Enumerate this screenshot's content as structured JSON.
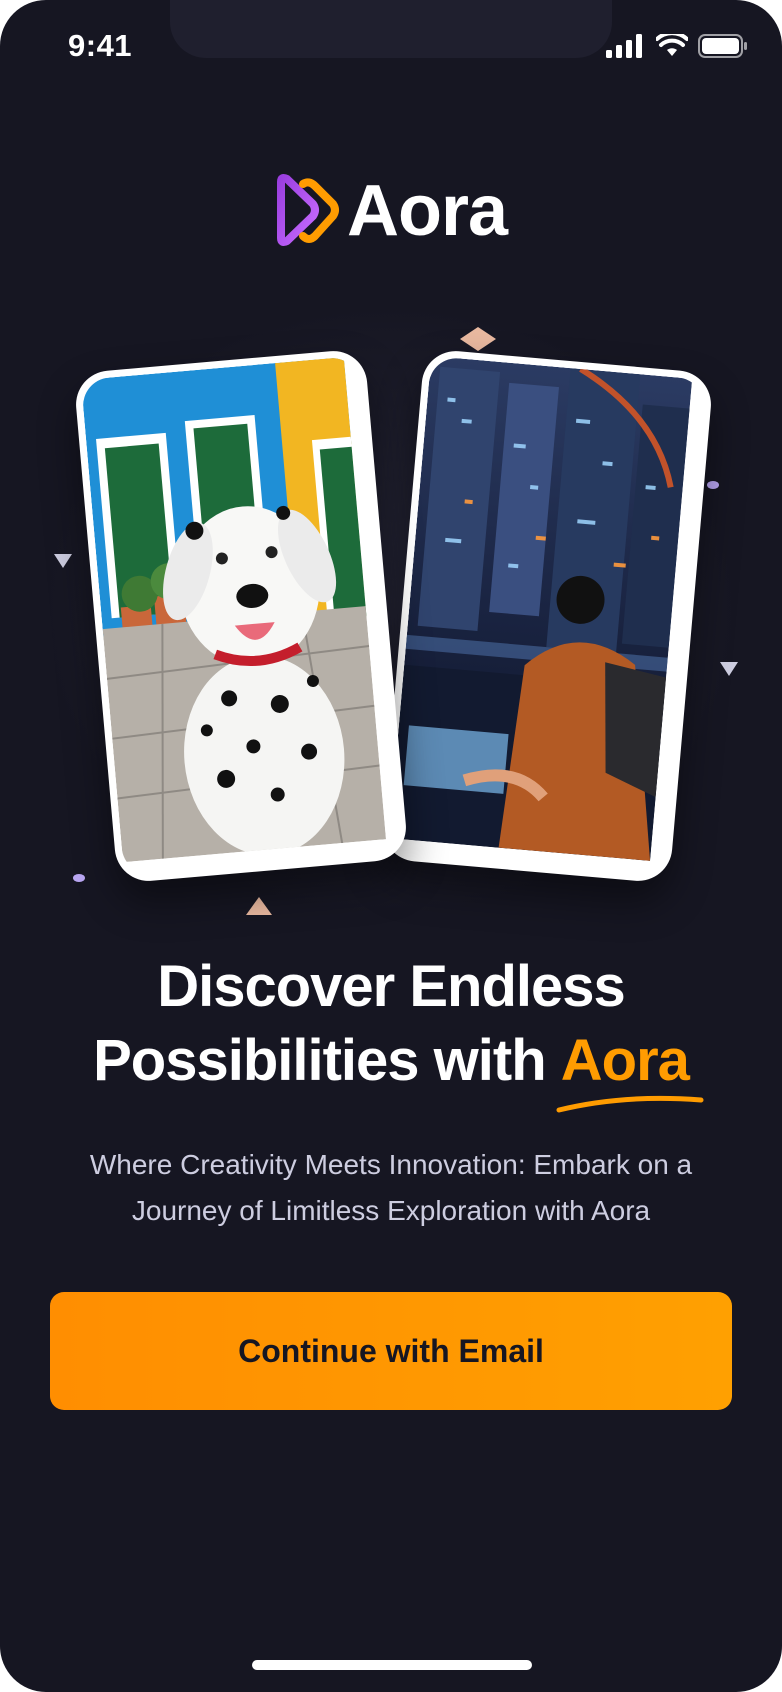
{
  "status_bar": {
    "time": "9:41"
  },
  "brand": {
    "name": "Aora",
    "logo_colors": [
      "#8B3FD9",
      "#FF9C01"
    ]
  },
  "hero": {
    "cards": [
      {
        "name": "dalmatian-dog-photo"
      },
      {
        "name": "cyberpunk-city-photo"
      }
    ]
  },
  "headline": {
    "line1": "Discover Endless",
    "line2_prefix": "Possibilities with ",
    "accent": "Aora",
    "accent_color": "#FF9C01"
  },
  "subtitle": "Where Creativity Meets Innovation: Embark on a Journey of Limitless Exploration with Aora",
  "cta": {
    "label": "Continue with Email",
    "gradient": [
      "#FF8E01",
      "#FFA001"
    ]
  },
  "colors": {
    "background": "#161622",
    "text": "#FFFFFF",
    "muted": "#CDCDE0"
  }
}
